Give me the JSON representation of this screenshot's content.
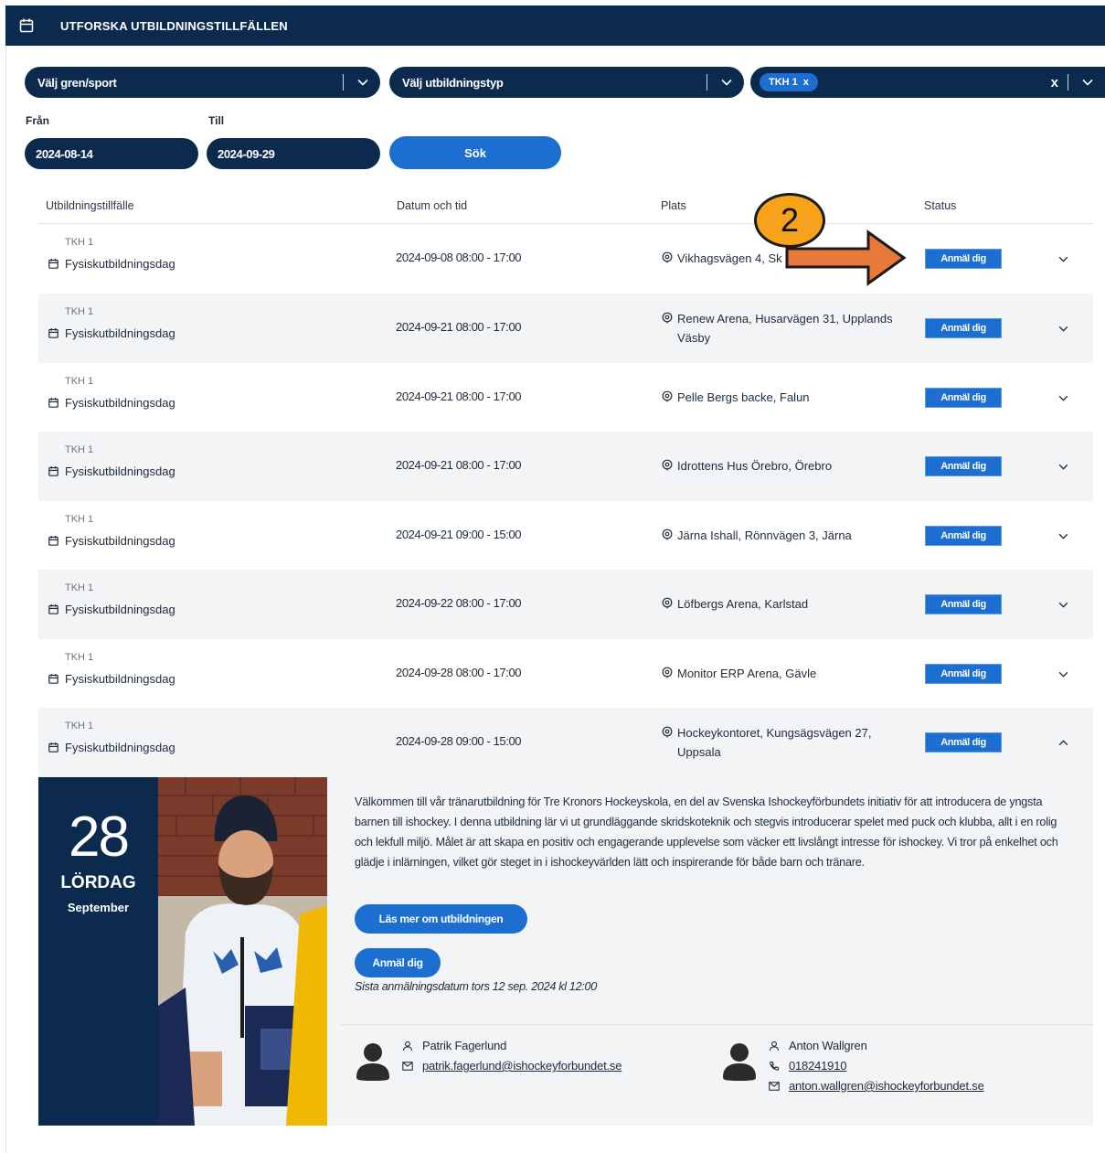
{
  "header": {
    "title": "UTFORSKA UTBILDNINGSTILLFÄLLEN"
  },
  "filters": {
    "sport_placeholder": "Välj gren/sport",
    "type_placeholder": "Välj utbildningstyp",
    "selected_tag": "TKH 1",
    "tag_remove": "x",
    "clear_all": "x",
    "from_label": "Från",
    "to_label": "Till",
    "from_value": "2024-08-14",
    "to_value": "2024-09-29",
    "search_label": "Sök"
  },
  "table": {
    "columns": [
      "Utbildningstillfälle",
      "Datum och tid",
      "Plats",
      "Status"
    ],
    "rows": [
      {
        "code": "TKH 1",
        "name": "Fysiskutbildningsdag",
        "when": "2024-09-08 08:00 - 17:00",
        "place": "Vikhagsvägen 4, Sk",
        "status": "Anmäl dig"
      },
      {
        "code": "TKH 1",
        "name": "Fysiskutbildningsdag",
        "when": "2024-09-21 08:00 - 17:00",
        "place": "Renew Arena, Husarvägen 31, Upplands Väsby",
        "status": "Anmäl dig"
      },
      {
        "code": "TKH 1",
        "name": "Fysiskutbildningsdag",
        "when": "2024-09-21 08:00 - 17:00",
        "place": "Pelle Bergs backe, Falun",
        "status": "Anmäl dig"
      },
      {
        "code": "TKH 1",
        "name": "Fysiskutbildningsdag",
        "when": "2024-09-21 08:00 - 17:00",
        "place": "Idrottens Hus Örebro, Örebro",
        "status": "Anmäl dig"
      },
      {
        "code": "TKH 1",
        "name": "Fysiskutbildningsdag",
        "when": "2024-09-21 09:00 - 15:00",
        "place": "Järna Ishall, Rönnvägen 3, Järna",
        "status": "Anmäl dig"
      },
      {
        "code": "TKH 1",
        "name": "Fysiskutbildningsdag",
        "when": "2024-09-22 08:00 - 17:00",
        "place": "Löfbergs Arena, Karlstad",
        "status": "Anmäl dig"
      },
      {
        "code": "TKH 1",
        "name": "Fysiskutbildningsdag",
        "when": "2024-09-28 08:00 - 17:00",
        "place": "Monitor ERP Arena, Gävle",
        "status": "Anmäl dig"
      },
      {
        "code": "TKH 1",
        "name": "Fysiskutbildningsdag",
        "when": "2024-09-28 09:00 - 15:00",
        "place": "Hockeykontoret, Kungsägsvägen 27, Uppsala",
        "status": "Anmäl dig"
      }
    ]
  },
  "details": {
    "day": "28",
    "weekday": "LÖRDAG",
    "month": "September",
    "description": "Välkommen till vår tränarutbildning för Tre Kronors Hockeyskola, en del av Svenska Ishockeyförbundets initiativ för att introducera de yngsta barnen till ishockey. I denna utbildning lär vi ut grundläggande skridskoteknik och stegvis introducerar spelet med puck och klubba, allt i en rolig och lekfull miljö. Målet är att skapa en positiv och engagerande upplevelse som väcker ett livslångt intresse för ishockey. Vi tror på enkelhet och glädje i inlärningen, vilket gör steget in i ishockeyvärlden lätt och inspirerande för både barn och tränare.",
    "more_button": "Läs mer om utbildningen",
    "register_button": "Anmäl dig",
    "deadline": "Sista anmälningsdatum tors 12 sep. 2024 kl 12:00",
    "contacts": [
      {
        "name": "Patrik Fagerlund",
        "email": "patrik.fagerlund@ishockeyforbundet.se"
      },
      {
        "name": "Anton Wallgren",
        "phone": "018241910",
        "email": "anton.wallgren@ishockeyforbundet.se"
      }
    ]
  },
  "annotation": {
    "number": "2"
  },
  "colors": {
    "navy": "#0c2a4e",
    "blue": "#1c6ed1",
    "row_alt": "#f2f4f6",
    "badge": "#f6a21b",
    "arrow": "#e8793a"
  }
}
